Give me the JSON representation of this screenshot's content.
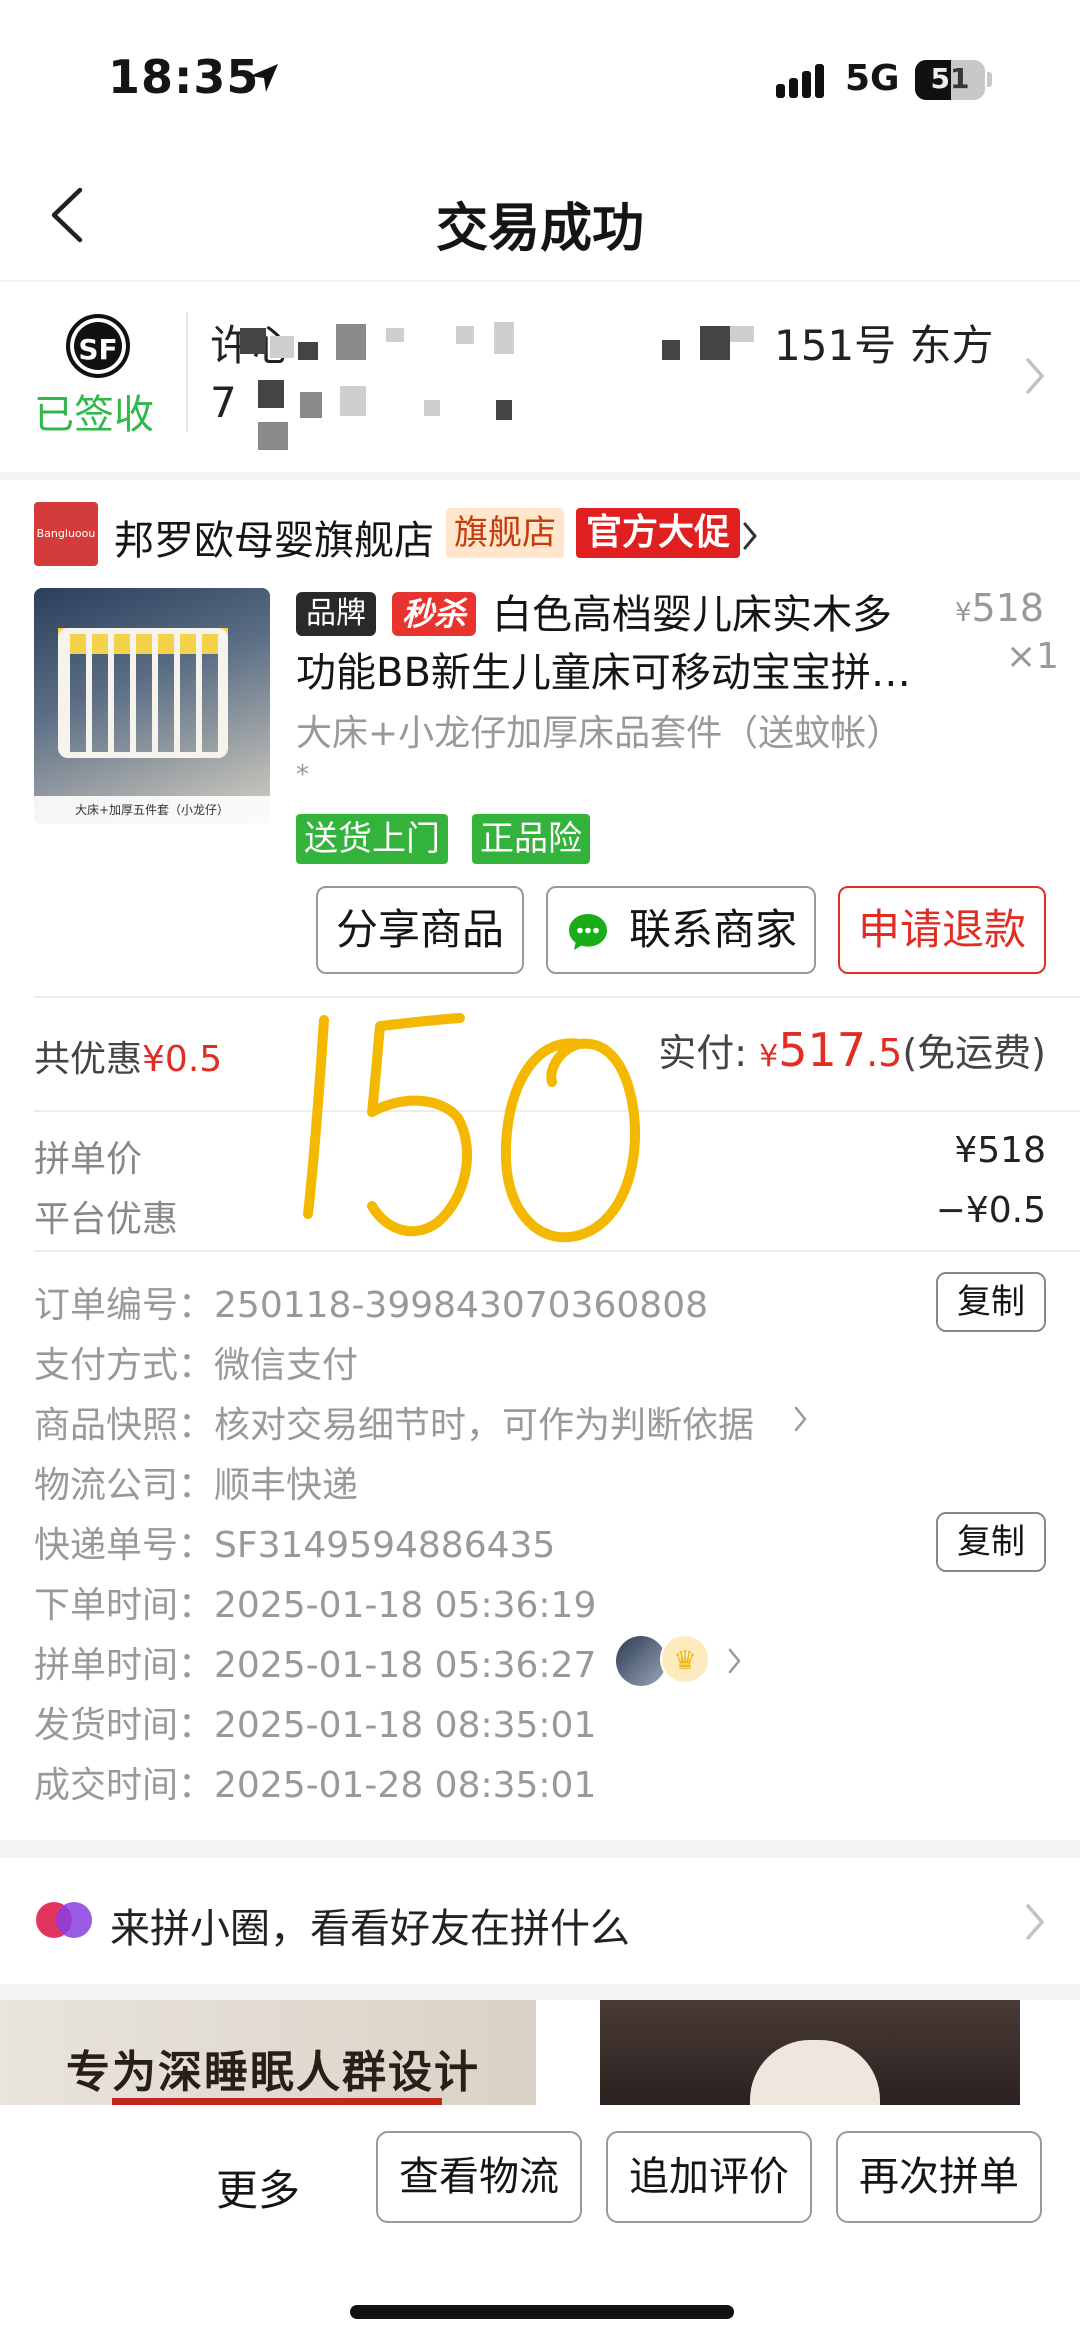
{
  "status_bar": {
    "time": "18:35",
    "network": "5G",
    "battery": "51"
  },
  "header": {
    "title": "交易成功"
  },
  "delivery": {
    "carrier_logo": "SF",
    "status": "已签收",
    "address_line1_start": "许心",
    "address_line1_end": "151号 东方",
    "address_line2": "7"
  },
  "shop": {
    "logo_text": "Bangluoou",
    "name": "邦罗欧母婴旗舰店",
    "flag_badge": "旗舰店",
    "promo_badge": "官方大促"
  },
  "product": {
    "brand_tag": "品牌",
    "flash_tag": "秒杀",
    "title": "白色高档婴儿床实木多功能BB新生儿童床可移动宝宝拼…",
    "image_caption": "大床+加厚五件套（小龙仔）",
    "price_currency": "¥",
    "price": "518",
    "quantity": "×1",
    "sku": "大床+小龙仔加厚床品套件（送蚊帐）",
    "sku_star": "*",
    "service_tags": [
      "送货上门",
      "正品险"
    ]
  },
  "actions": {
    "share": "分享商品",
    "contact": "联系商家",
    "refund": "申请退款"
  },
  "summary": {
    "discount_label": "共优惠",
    "discount_value": "¥0.5",
    "paid_label": "实付: ",
    "paid_currency": "¥",
    "paid_int": "517",
    "paid_dec": ".5",
    "paid_note": "(免运费)"
  },
  "handwriting": "150",
  "breakdown": [
    {
      "label": "拼单价",
      "value": "¥518"
    },
    {
      "label": "平台优惠",
      "value": "−¥0.5"
    }
  ],
  "details": {
    "order_no_label": "订单编号：",
    "order_no": "250118-399843070360808",
    "pay_label": "支付方式：",
    "pay_value": "微信支付",
    "snapshot_label": "商品快照：",
    "snapshot_value": "核对交易细节时，可作为判断依据",
    "logistics_label": "物流公司：",
    "logistics_value": "顺丰快递",
    "tracking_label": "快递单号：",
    "tracking_value": "SF3149594886435",
    "order_time_label": "下单时间：",
    "order_time": "2025-01-18 05:36:19",
    "group_time_label": "拼单时间：",
    "group_time": "2025-01-18 05:36:27",
    "ship_time_label": "发货时间：",
    "ship_time": "2025-01-18 08:35:01",
    "deal_time_label": "成交时间：",
    "deal_time": "2025-01-28 08:35:01",
    "copy_label": "复制"
  },
  "circle": {
    "text": "来拼小圈，看看好友在拼什么"
  },
  "banner": {
    "text": "专为深睡眠人群设计"
  },
  "bottom_bar": {
    "more": "更多",
    "logistics": "查看物流",
    "review": "追加评价",
    "rebuy": "再次拼单"
  },
  "colors": {
    "accent_red": "#e02e24",
    "success_green": "#32b84a",
    "tag_green": "#33b33b",
    "handwriting": "#f5b800"
  }
}
